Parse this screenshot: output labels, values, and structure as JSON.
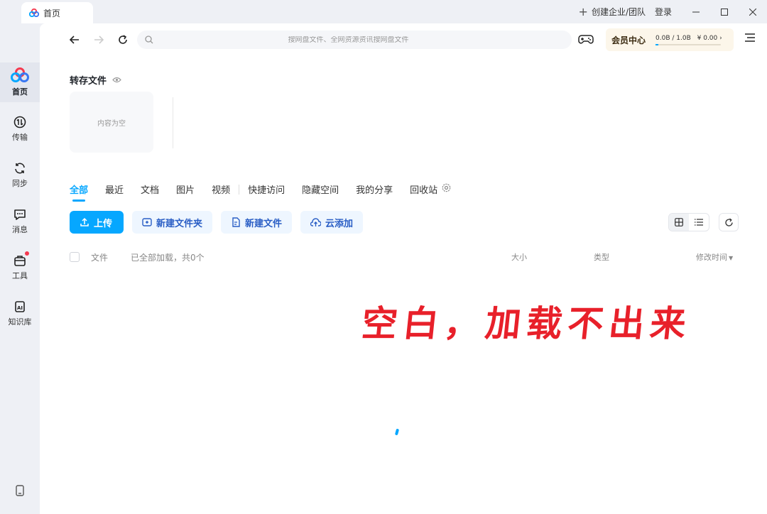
{
  "titlebar": {
    "tab_label": "首页",
    "create_team": "创建企业/团队",
    "login": "登录",
    "minimize_icon": "minimize-icon",
    "maximize_icon": "maximize-icon",
    "close_icon": "close-icon"
  },
  "sidebar": {
    "items": [
      {
        "label": "首页",
        "icon": "baidu-pan-logo",
        "active": true
      },
      {
        "label": "传输",
        "icon": "transfer-icon"
      },
      {
        "label": "同步",
        "icon": "sync-icon"
      },
      {
        "label": "消息",
        "icon": "message-icon"
      },
      {
        "label": "工具",
        "icon": "toolbox-icon",
        "badge": true
      },
      {
        "label": "知识库",
        "icon": "ai-knowledge-icon"
      }
    ],
    "bottom_icon": "phone-icon"
  },
  "toolbar": {
    "search_placeholder": "搜网盘文件、全网资源资讯搜网盘文件",
    "vip_label": "会员中心",
    "storage": "0.0B / 1.0B",
    "balance": "¥ 0.00",
    "storage_used_fraction": 0.0
  },
  "transfer": {
    "title": "转存文件",
    "empty_text": "内容为空"
  },
  "tabs": [
    "全部",
    "最近",
    "文档",
    "图片",
    "视频",
    "快捷访问",
    "隐藏空间",
    "我的分享",
    "回收站"
  ],
  "actions": {
    "upload": "上传",
    "new_folder": "新建文件夹",
    "new_file": "新建文件",
    "cloud_add": "云添加"
  },
  "list": {
    "col_file": "文件",
    "loaded_status": "已全部加载，共0个",
    "col_size": "大小",
    "col_type": "类型",
    "col_time": "修改时间"
  },
  "annotation": "空白，加载不出来",
  "colors": {
    "accent": "#06a7ff",
    "annotation": "#e8202a",
    "vip_bg": "#fcf6ea"
  }
}
